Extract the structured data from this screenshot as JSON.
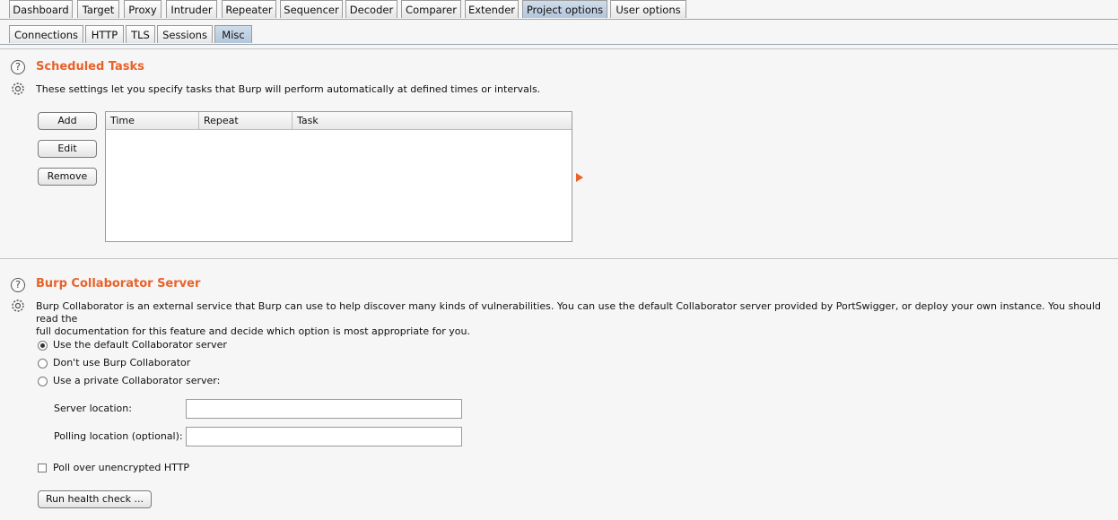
{
  "top_tabs": [
    "Dashboard",
    "Target",
    "Proxy",
    "Intruder",
    "Repeater",
    "Sequencer",
    "Decoder",
    "Comparer",
    "Extender",
    "Project options",
    "User options"
  ],
  "sub_tabs": [
    "Connections",
    "HTTP",
    "TLS",
    "Sessions",
    "Misc"
  ],
  "active_top_tab": "Project options",
  "active_sub_tab": "Misc",
  "scheduled_tasks": {
    "title": "Scheduled Tasks",
    "description": "These settings let you specify tasks that Burp will perform automatically at defined times or intervals.",
    "buttons": {
      "add": "Add",
      "edit": "Edit",
      "remove": "Remove"
    },
    "columns": [
      "Time",
      "Repeat",
      "Task"
    ]
  },
  "collaborator": {
    "title": "Burp Collaborator Server",
    "description_line1": "Burp Collaborator is an external service that Burp can use to help discover many kinds of vulnerabilities. You can use the default Collaborator server provided by PortSwigger, or deploy your own instance. You should read the",
    "description_line2": "full documentation for this feature and decide which option is most appropriate for you.",
    "options": {
      "default": "Use the default Collaborator server",
      "none": "Don't use Burp Collaborator",
      "private": "Use a private Collaborator server:"
    },
    "selected_option": "default",
    "server_location_label": "Server location:",
    "server_location_value": "",
    "polling_location_label": "Polling location (optional):",
    "polling_location_value": "",
    "poll_unencrypted_label": "Poll over unencrypted HTTP",
    "poll_unencrypted_checked": false,
    "health_check_button": "Run health check ..."
  },
  "colors": {
    "accent": "#e8622a",
    "active_tab": "#b3c6db"
  }
}
